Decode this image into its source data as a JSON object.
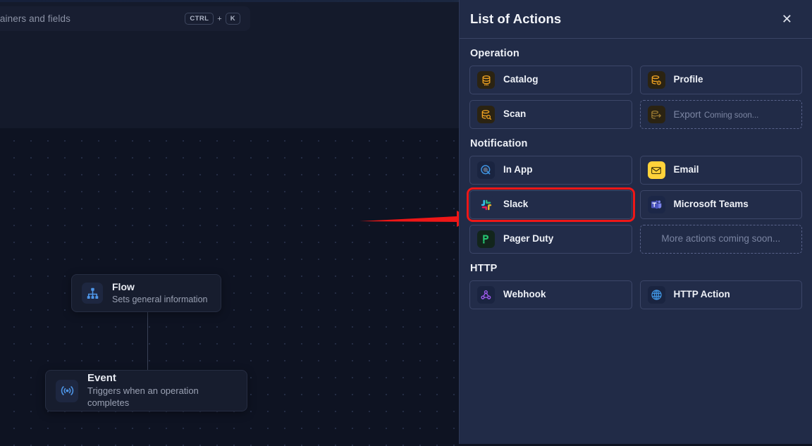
{
  "canvas": {
    "search": {
      "placeholder": "containers and fields",
      "shortcut_key1": "CTRL",
      "shortcut_plus": "+",
      "shortcut_key2": "K"
    },
    "nodes": [
      {
        "title": "Flow",
        "subtitle": "Sets general information",
        "icon": "sitemap-icon"
      },
      {
        "title": "Event",
        "subtitle": "Triggers when an operation completes",
        "icon": "broadcast-icon"
      }
    ]
  },
  "panel": {
    "title": "List of Actions",
    "close_label": "✕",
    "sections": [
      {
        "title": "Operation",
        "items": [
          {
            "label": "Catalog",
            "sub": "",
            "icon": "database-icon",
            "state": "enabled",
            "selected": false
          },
          {
            "label": "Profile",
            "sub": "",
            "icon": "database-gear-icon",
            "state": "enabled",
            "selected": false
          },
          {
            "label": "Scan",
            "sub": "",
            "icon": "database-search-icon",
            "state": "enabled",
            "selected": false
          },
          {
            "label": "Export",
            "sub": "Coming soon...",
            "icon": "database-export-icon",
            "state": "disabled",
            "selected": false
          }
        ]
      },
      {
        "title": "Notification",
        "items": [
          {
            "label": "In App",
            "sub": "",
            "icon": "in-app-icon",
            "state": "enabled",
            "selected": false
          },
          {
            "label": "Email",
            "sub": "",
            "icon": "envelope-icon",
            "state": "enabled",
            "selected": false
          },
          {
            "label": "Slack",
            "sub": "",
            "icon": "slack-icon",
            "state": "enabled",
            "selected": true
          },
          {
            "label": "Microsoft Teams",
            "sub": "",
            "icon": "microsoft-teams-icon",
            "state": "enabled",
            "selected": false
          },
          {
            "label": "Pager Duty",
            "sub": "",
            "icon": "pagerduty-icon",
            "state": "enabled",
            "selected": false
          },
          {
            "label": "More actions coming soon...",
            "sub": "",
            "icon": "",
            "state": "placeholder",
            "selected": false
          }
        ]
      },
      {
        "title": "HTTP",
        "items": [
          {
            "label": "Webhook",
            "sub": "",
            "icon": "webhook-icon",
            "state": "enabled",
            "selected": false
          },
          {
            "label": "HTTP Action",
            "sub": "",
            "icon": "globe-icon",
            "state": "enabled",
            "selected": false
          }
        ]
      }
    ]
  },
  "annotation": {
    "type": "red-arrow",
    "points_to": "Slack",
    "color": "#ef1717"
  }
}
